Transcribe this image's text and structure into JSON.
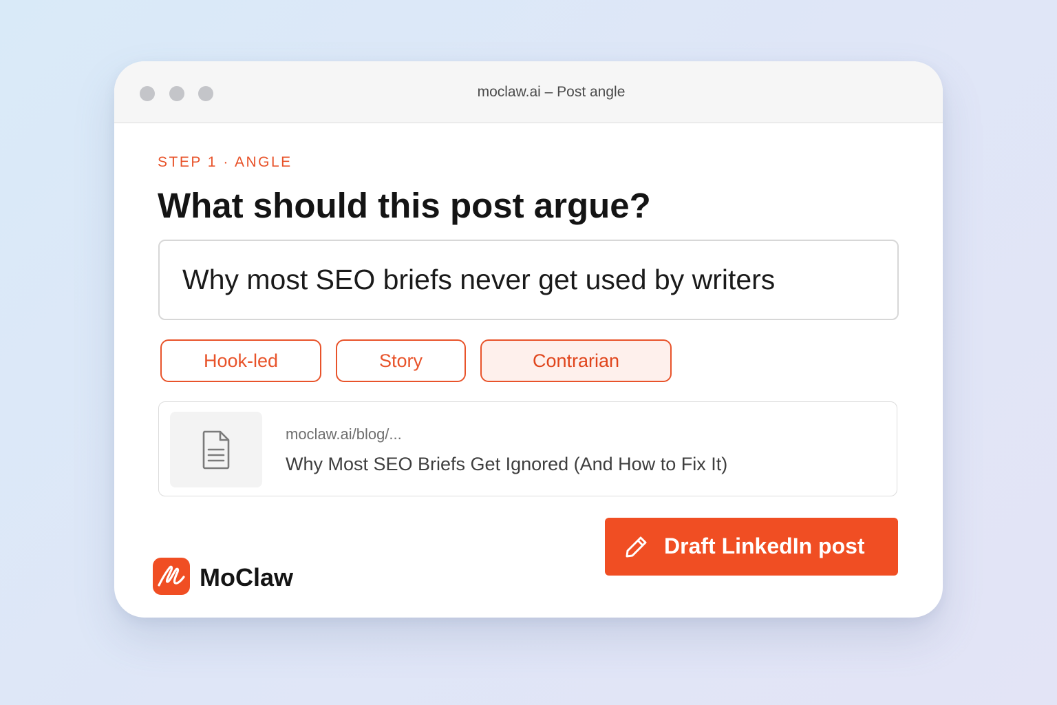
{
  "window": {
    "title": "moclaw.ai – Post angle"
  },
  "step": {
    "label": "STEP 1 · ANGLE"
  },
  "heading": "What should this post argue?",
  "angle_input": {
    "value": "Why most SEO briefs never get used by writers"
  },
  "angle_styles": [
    {
      "label": "Hook-led",
      "selected": false
    },
    {
      "label": "Story",
      "selected": false
    },
    {
      "label": "Contrarian",
      "selected": true
    }
  ],
  "source": {
    "icon": "document-icon",
    "url": "moclaw.ai/blog/...",
    "title": "Why Most SEO Briefs Get Ignored (And How to Fix It)"
  },
  "actions": {
    "draft_label": "Draft LinkedIn post",
    "draft_icon": "pencil-icon"
  },
  "brand": {
    "name": "MoClaw",
    "logo_icon": "moclaw-logo"
  },
  "colors": {
    "accent": "#f04e23",
    "chip_selected_bg": "#fef0ec",
    "titlebar_bg": "#f6f6f6"
  }
}
